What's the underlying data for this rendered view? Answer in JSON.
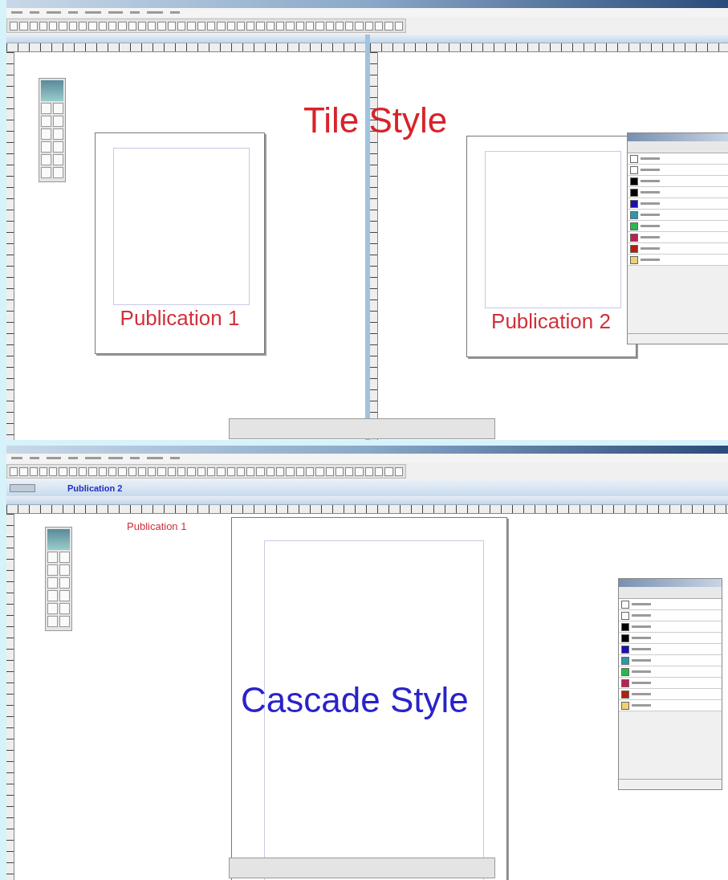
{
  "tile_screen": {
    "windows": [
      {
        "page_label": "Publication 1"
      },
      {
        "page_label": "Publication 2"
      }
    ],
    "annotation": "Tile Style",
    "colors": [
      {
        "color": "#ffffff"
      },
      {
        "color": "#ffffff"
      },
      {
        "color": "#000000"
      },
      {
        "color": "#000000"
      },
      {
        "color": "#1a10b0"
      },
      {
        "color": "#2a9aa8"
      },
      {
        "color": "#2ab84a"
      },
      {
        "color": "#c02050"
      },
      {
        "color": "#b02010"
      },
      {
        "color": "#f0d070"
      }
    ]
  },
  "cascade_screen": {
    "back_window_label": "Publication 2",
    "page_label": "Publication 1",
    "annotation": "Cascade Style",
    "colors": [
      {
        "color": "#ffffff"
      },
      {
        "color": "#ffffff"
      },
      {
        "color": "#000000"
      },
      {
        "color": "#000000"
      },
      {
        "color": "#1a10b0"
      },
      {
        "color": "#2a9aa8"
      },
      {
        "color": "#2ab84a"
      },
      {
        "color": "#c02050"
      },
      {
        "color": "#b02010"
      },
      {
        "color": "#f0d070"
      }
    ]
  }
}
